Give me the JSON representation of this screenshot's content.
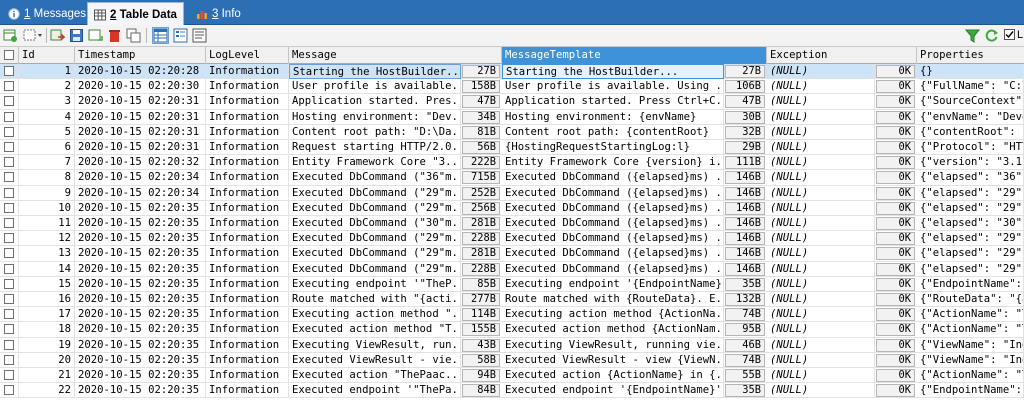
{
  "tabs": [
    {
      "num": "1",
      "label": "Messages",
      "icon": "info-icon"
    },
    {
      "num": "2",
      "label": "Table Data",
      "icon": "table-icon"
    },
    {
      "num": "3",
      "label": "Info",
      "icon": "chart-icon"
    }
  ],
  "toolbar": {
    "filter_label": "L",
    "icons": [
      "grid-refresh-icon",
      "dropdown-grid-icon",
      "export-icon",
      "save-icon",
      "import-icon",
      "delete-icon",
      "copy-icon",
      "grid-view-icon",
      "form-view-icon",
      "text-view-icon",
      "filter-icon",
      "refresh-icon",
      "checkbox-icon"
    ]
  },
  "columns": [
    "",
    "Id",
    "Timestamp",
    "LogLevel",
    "Message",
    "MessageTemplate",
    "Exception",
    "Properties"
  ],
  "rows": [
    {
      "id": "1",
      "ts": "2020-10-15 02:20:28",
      "level": "Information",
      "msg": "Starting the HostBuilder...",
      "msg_size": "27B",
      "tmpl": "Starting the HostBuilder...",
      "tmpl_size": "27B",
      "exc": "(NULL)",
      "exc_size": "0K",
      "props": "{}"
    },
    {
      "id": "2",
      "ts": "2020-10-15 02:20:30",
      "level": "Information",
      "msg": "User profile is available...",
      "msg_size": "158B",
      "tmpl": "User profile is available. Using ...",
      "tmpl_size": "106B",
      "exc": "(NULL)",
      "exc_size": "0K",
      "props": "{\"FullName\": \"C:\\\\"
    },
    {
      "id": "3",
      "ts": "2020-10-15 02:20:31",
      "level": "Information",
      "msg": "Application started. Pres...",
      "msg_size": "47B",
      "tmpl": "Application started. Press Ctrl+C...",
      "tmpl_size": "47B",
      "exc": "(NULL)",
      "exc_size": "0K",
      "props": "{\"SourceContext\":"
    },
    {
      "id": "4",
      "ts": "2020-10-15 02:20:31",
      "level": "Information",
      "msg": "Hosting environment: \"Dev...",
      "msg_size": "34B",
      "tmpl": "Hosting environment: {envName}",
      "tmpl_size": "30B",
      "exc": "(NULL)",
      "exc_size": "0K",
      "props": "{\"envName\": \"Devel"
    },
    {
      "id": "5",
      "ts": "2020-10-15 02:20:31",
      "level": "Information",
      "msg": "Content root path: \"D:\\Da...",
      "msg_size": "81B",
      "tmpl": "Content root path: {contentRoot}",
      "tmpl_size": "32B",
      "exc": "(NULL)",
      "exc_size": "0K",
      "props": "{\"contentRoot\": \"D"
    },
    {
      "id": "6",
      "ts": "2020-10-15 02:20:31",
      "level": "Information",
      "msg": "Request starting HTTP/2.0...",
      "msg_size": "56B",
      "tmpl": "{HostingRequestStartingLog:l}",
      "tmpl_size": "29B",
      "exc": "(NULL)",
      "exc_size": "0K",
      "props": "{\"Protocol\": \"HTTP"
    },
    {
      "id": "7",
      "ts": "2020-10-15 02:20:32",
      "level": "Information",
      "msg": "Entity Framework Core \"3....",
      "msg_size": "222B",
      "tmpl": "Entity Framework Core {version} i...",
      "tmpl_size": "111B",
      "exc": "(NULL)",
      "exc_size": "0K",
      "props": "{\"version\": \"3.1.8"
    },
    {
      "id": "8",
      "ts": "2020-10-15 02:20:34",
      "level": "Information",
      "msg": "Executed DbCommand (\"36\"m...",
      "msg_size": "715B",
      "tmpl": "Executed DbCommand ({elapsed}ms) ...",
      "tmpl_size": "146B",
      "exc": "(NULL)",
      "exc_size": "0K",
      "props": "{\"elapsed\": \"36\",\""
    },
    {
      "id": "9",
      "ts": "2020-10-15 02:20:34",
      "level": "Information",
      "msg": "Executed DbCommand (\"29\"m...",
      "msg_size": "252B",
      "tmpl": "Executed DbCommand ({elapsed}ms) ...",
      "tmpl_size": "146B",
      "exc": "(NULL)",
      "exc_size": "0K",
      "props": "{\"elapsed\": \"29\",\""
    },
    {
      "id": "10",
      "ts": "2020-10-15 02:20:35",
      "level": "Information",
      "msg": "Executed DbCommand (\"29\"m...",
      "msg_size": "256B",
      "tmpl": "Executed DbCommand ({elapsed}ms) ...",
      "tmpl_size": "146B",
      "exc": "(NULL)",
      "exc_size": "0K",
      "props": "{\"elapsed\": \"29\",\""
    },
    {
      "id": "11",
      "ts": "2020-10-15 02:20:35",
      "level": "Information",
      "msg": "Executed DbCommand (\"30\"m...",
      "msg_size": "281B",
      "tmpl": "Executed DbCommand ({elapsed}ms) ...",
      "tmpl_size": "146B",
      "exc": "(NULL)",
      "exc_size": "0K",
      "props": "{\"elapsed\": \"30\",\""
    },
    {
      "id": "12",
      "ts": "2020-10-15 02:20:35",
      "level": "Information",
      "msg": "Executed DbCommand (\"29\"m...",
      "msg_size": "228B",
      "tmpl": "Executed DbCommand ({elapsed}ms) ...",
      "tmpl_size": "146B",
      "exc": "(NULL)",
      "exc_size": "0K",
      "props": "{\"elapsed\": \"29\",\""
    },
    {
      "id": "13",
      "ts": "2020-10-15 02:20:35",
      "level": "Information",
      "msg": "Executed DbCommand (\"29\"m...",
      "msg_size": "281B",
      "tmpl": "Executed DbCommand ({elapsed}ms) ...",
      "tmpl_size": "146B",
      "exc": "(NULL)",
      "exc_size": "0K",
      "props": "{\"elapsed\": \"29\",\""
    },
    {
      "id": "14",
      "ts": "2020-10-15 02:20:35",
      "level": "Information",
      "msg": "Executed DbCommand (\"29\"m...",
      "msg_size": "228B",
      "tmpl": "Executed DbCommand ({elapsed}ms) ...",
      "tmpl_size": "146B",
      "exc": "(NULL)",
      "exc_size": "0K",
      "props": "{\"elapsed\": \"29\",\""
    },
    {
      "id": "15",
      "ts": "2020-10-15 02:20:35",
      "level": "Information",
      "msg": "Executing endpoint '\"TheP...",
      "msg_size": "85B",
      "tmpl": "Executing endpoint '{EndpointName}'",
      "tmpl_size": "35B",
      "exc": "(NULL)",
      "exc_size": "0K",
      "props": "{\"EndpointName\": \""
    },
    {
      "id": "16",
      "ts": "2020-10-15 02:20:35",
      "level": "Information",
      "msg": "Route matched with \"{acti...",
      "msg_size": "277B",
      "tmpl": "Route matched with {RouteData}. E...",
      "tmpl_size": "132B",
      "exc": "(NULL)",
      "exc_size": "0K",
      "props": "{\"RouteData\": \"{ac"
    },
    {
      "id": "17",
      "ts": "2020-10-15 02:20:35",
      "level": "Information",
      "msg": "Executing action method \"...",
      "msg_size": "114B",
      "tmpl": "Executing action method {ActionNa...",
      "tmpl_size": "74B",
      "exc": "(NULL)",
      "exc_size": "0K",
      "props": "{\"ActionName\": \"Th"
    },
    {
      "id": "18",
      "ts": "2020-10-15 02:20:35",
      "level": "Information",
      "msg": "Executed action method \"T...",
      "msg_size": "155B",
      "tmpl": "Executed action method {ActionNam...",
      "tmpl_size": "95B",
      "exc": "(NULL)",
      "exc_size": "0K",
      "props": "{\"ActionName\": \"Th"
    },
    {
      "id": "19",
      "ts": "2020-10-15 02:20:35",
      "level": "Information",
      "msg": "Executing ViewResult, run...",
      "msg_size": "43B",
      "tmpl": "Executing ViewResult, running vie...",
      "tmpl_size": "46B",
      "exc": "(NULL)",
      "exc_size": "0K",
      "props": "{\"ViewName\": \"Inde"
    },
    {
      "id": "20",
      "ts": "2020-10-15 02:20:35",
      "level": "Information",
      "msg": "Executed ViewResult - vie...",
      "msg_size": "58B",
      "tmpl": "Executed ViewResult - view {ViewN...",
      "tmpl_size": "74B",
      "exc": "(NULL)",
      "exc_size": "0K",
      "props": "{\"ViewName\": \"Inde"
    },
    {
      "id": "21",
      "ts": "2020-10-15 02:20:35",
      "level": "Information",
      "msg": "Executed action \"ThePaac...",
      "msg_size": "94B",
      "tmpl": "Executed action {ActionName} in {...",
      "tmpl_size": "55B",
      "exc": "(NULL)",
      "exc_size": "0K",
      "props": "{\"ActionName\": \"Th"
    },
    {
      "id": "22",
      "ts": "2020-10-15 02:20:35",
      "level": "Information",
      "msg": "Executed endpoint '\"ThePa...",
      "msg_size": "84B",
      "tmpl": "Executed endpoint '{EndpointName}'",
      "tmpl_size": "35B",
      "exc": "(NULL)",
      "exc_size": "0K",
      "props": "{\"EndpointName\": \""
    }
  ]
}
